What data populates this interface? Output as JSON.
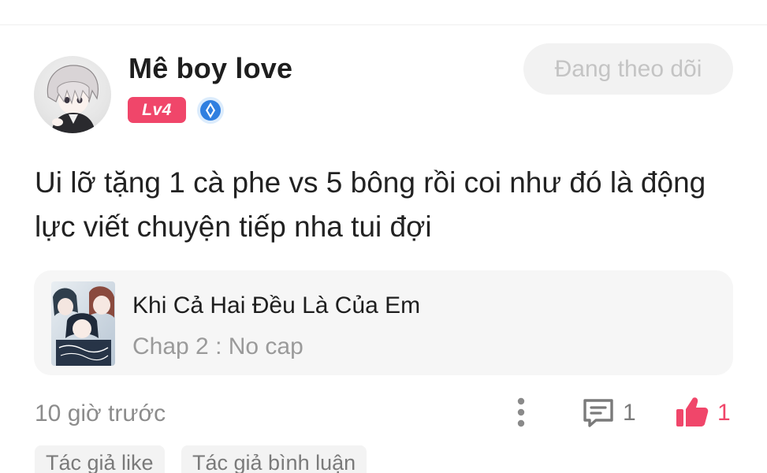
{
  "user": {
    "name": "Mê boy love",
    "level": "Lv4",
    "follow_label": "Đang theo dõi"
  },
  "comment": {
    "text": "Ui lỡ tặng 1 cà phe vs 5 bông rồi coi như đó là động lực viết chuyện tiếp nha tui đợi"
  },
  "story": {
    "title": "Khi Cả Hai Đều Là Của Em",
    "chapter": "Chap 2 : No cap"
  },
  "footer": {
    "timestamp": "10 giờ trước",
    "comment_count": "1",
    "like_count": "1"
  },
  "tags": [
    {
      "label": "Tác giả like"
    },
    {
      "label": "Tác giả bình luận"
    }
  ],
  "icons": {
    "verified": "verified-badge-icon",
    "more": "more-vertical-icon",
    "comment": "comment-icon",
    "like": "thumbs-up-icon"
  },
  "colors": {
    "accent": "#f0466a",
    "verified": "#2f7fe0",
    "muted_text": "#8c8c8c"
  }
}
